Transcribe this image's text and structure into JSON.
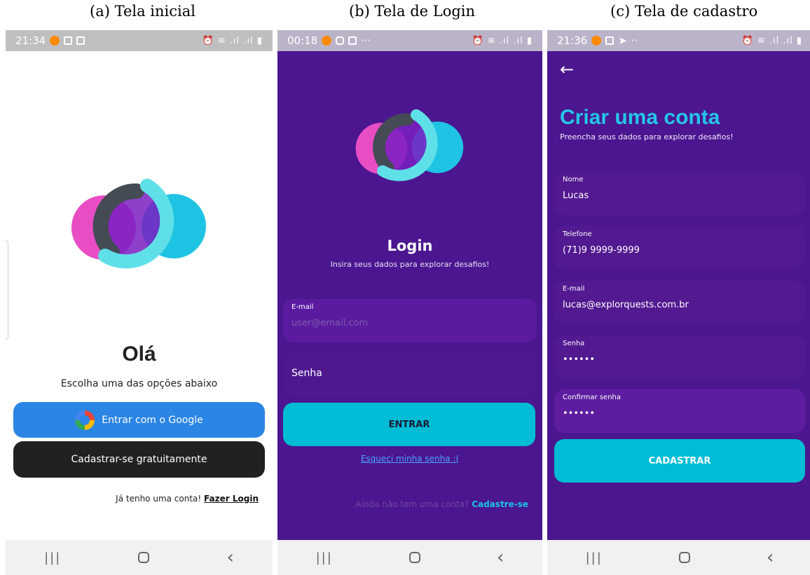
{
  "captions": {
    "a": "(a) Tela inicial",
    "b": "(b) Tela de Login",
    "c": "(c) Tela de cadastro"
  },
  "colors": {
    "purple_bg": "#4b1690",
    "cyan": "#00bcd4",
    "google_blue": "#2b85e4",
    "dark_button": "#212121"
  },
  "screen_a": {
    "time": "21:34",
    "greeting": "Olá",
    "instruction": "Escolha uma das opções abaixo",
    "google_button": "Entrar com o Google",
    "register_button": "Cadastrar-se gratuitamente",
    "have_account_text": "Já tenho uma conta!",
    "login_link": "Fazer Login"
  },
  "screen_b": {
    "time": "00:18",
    "status_extra": "···",
    "title": "Login",
    "subtitle": "Insira seus dados para explorar desafios!",
    "email_label": "E-mail",
    "email_placeholder": "user@email.com",
    "password_placeholder": "Senha",
    "submit_button": "ENTRAR",
    "forgot_link": "Esqueci minha senha :(",
    "no_account_text": "Ainda não tem uma conta?",
    "signup_link": "Cadastre-se"
  },
  "screen_c": {
    "time": "21:36",
    "status_extra": "··",
    "title": "Criar uma conta",
    "subtitle": "Preencha seus dados para explorar desafios!",
    "fields": [
      {
        "label": "Nome",
        "value": "Lucas"
      },
      {
        "label": "Telefone",
        "value": "(71)9 9999-9999"
      },
      {
        "label": "E-mail",
        "value": "lucas@explorquests.com.br"
      },
      {
        "label": "Senha",
        "value": "••••••"
      },
      {
        "label": "Confirmar senha",
        "value": "••••••"
      }
    ],
    "submit_button": "CADASTRAR"
  },
  "icons": {
    "status_right": "signal-wifi-battery-icons",
    "nav": [
      "recent-apps-icon",
      "home-icon",
      "back-icon"
    ]
  }
}
